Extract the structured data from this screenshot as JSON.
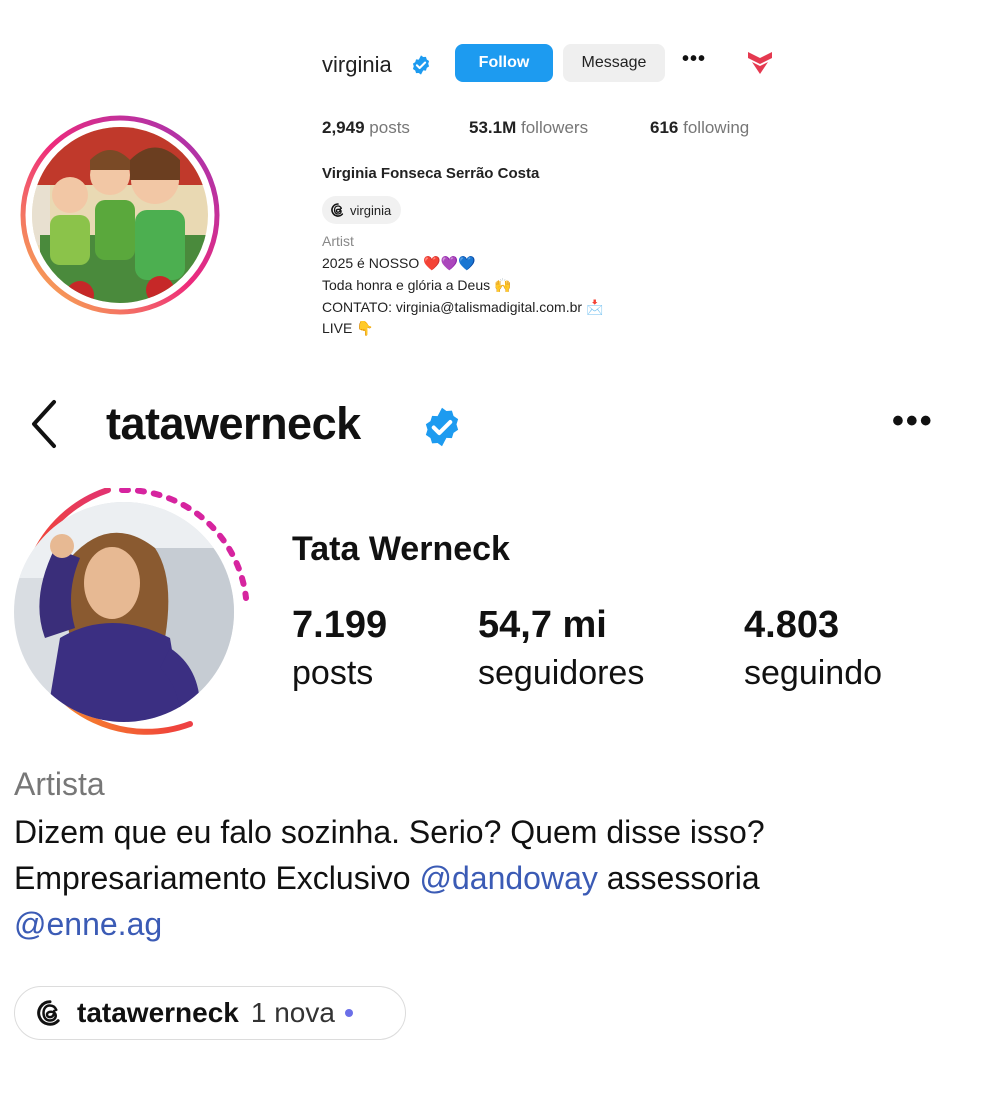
{
  "profile_top": {
    "username": "virginia",
    "follow_label": "Follow",
    "message_label": "Message",
    "more_label": "•••",
    "stats": {
      "posts_count": "2,949",
      "posts_label": "posts",
      "followers_count": "53.1M",
      "followers_label": "followers",
      "following_count": "616",
      "following_label": "following"
    },
    "full_name": "Virginia Fonseca Serrão Costa",
    "threads_handle": "virginia",
    "category": "Artist",
    "bio_lines": [
      "2025 é NOSSO ❤️💜💙",
      "Toda honra e glória a Deus 🙌",
      "CONTATO: virginia@talismadigital.com.br 📩",
      "LIVE 👇"
    ],
    "icons": {
      "verified": "verified-badge-icon",
      "accounts": "account-switch-icon",
      "threads": "threads-icon"
    },
    "colors": {
      "follow": "#1d9bf0",
      "verified": "#1d9bf0"
    }
  },
  "profile_main": {
    "username": "tatawerneck",
    "more_label": "•••",
    "full_name": "Tata Werneck",
    "stats": {
      "posts_count": "7.199",
      "posts_label": "posts",
      "followers_count": "54,7 mi",
      "followers_label": "seguidores",
      "following_count": "4.803",
      "following_label": "seguindo"
    },
    "category": "Artista",
    "bio_line_1": "Dizem que eu falo sozinha. Serio? Quem disse isso?",
    "bio_line_2_text": "Empresariamento Exclusivo ",
    "bio_line_2_link": "@dandoway",
    "bio_line_2_tail": " assessoria",
    "bio_line_3_link": "@enne.ag",
    "threads_handle": "tatawerneck",
    "threads_new": "1 nova",
    "icons": {
      "back": "back-chevron-icon",
      "verified": "verified-badge-icon",
      "threads": "threads-icon"
    },
    "colors": {
      "link": "#3b5bb5",
      "verified": "#1d9bf0",
      "new_dot": "#6b6fe8"
    }
  }
}
